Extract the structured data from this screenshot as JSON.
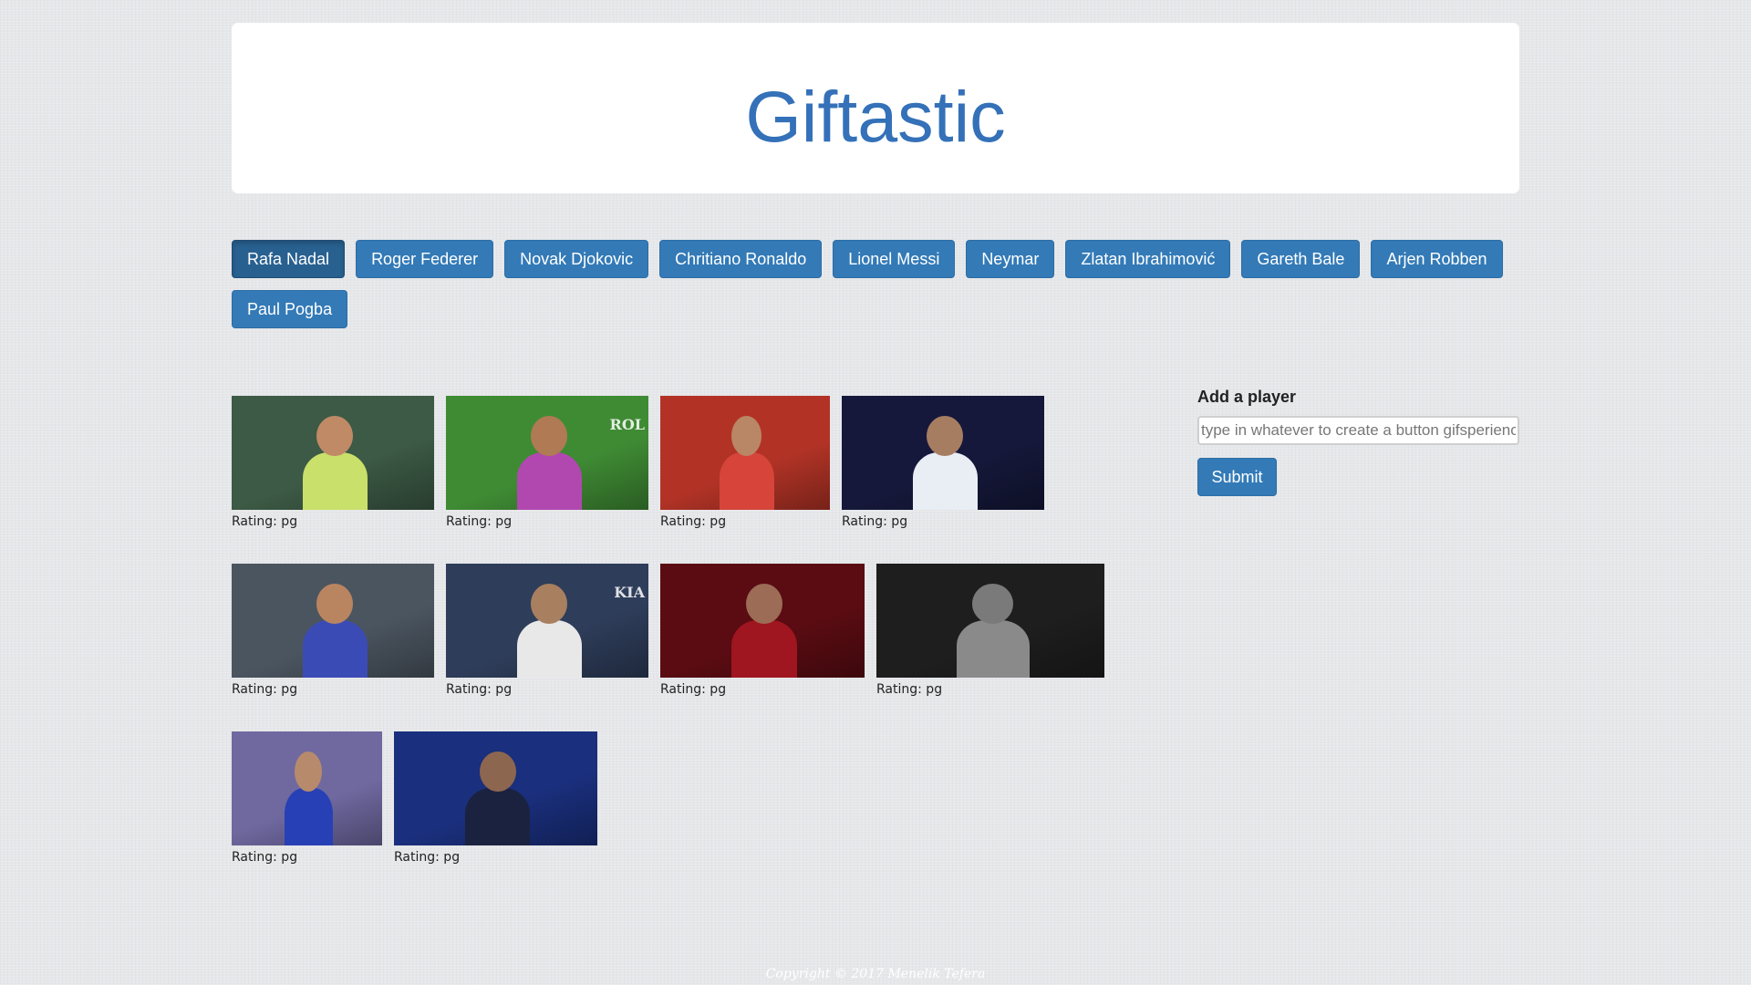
{
  "header": {
    "title": "Giftastic"
  },
  "player_buttons": [
    "Rafa Nadal",
    "Roger Federer",
    "Novak Djokovic",
    "Chritiano Ronaldo",
    "Lionel Messi",
    "Neymar",
    "Zlatan Ibrahimović",
    "Gareth Bale",
    "Arjen Robben",
    "Paul Pogba"
  ],
  "active_button": "Rafa Nadal",
  "gif_rows": [
    [
      {
        "rating": "Rating: pg",
        "bg": "#3c5a45",
        "accent": "#c9e06a",
        "skin": "#c08a66",
        "overlay": ""
      },
      {
        "rating": "Rating: pg",
        "bg": "#3f8b34",
        "accent": "#b048b0",
        "skin": "#b07a54",
        "overlay": "ROL"
      },
      {
        "rating": "Rating: pg",
        "bg": "#b23326",
        "accent": "#d6443a",
        "skin": "#b98765",
        "overlay": ""
      },
      {
        "rating": "Rating: pg",
        "bg": "#15183a",
        "accent": "#e9eef5",
        "skin": "#a77d62",
        "overlay": ""
      }
    ],
    [
      {
        "rating": "Rating: pg",
        "bg": "#4b5560",
        "accent": "#3b4bb5",
        "skin": "#b98560",
        "overlay": ""
      },
      {
        "rating": "Rating: pg",
        "bg": "#2e3d5a",
        "accent": "#e8e8e8",
        "skin": "#a8805f",
        "overlay": "KIA"
      },
      {
        "rating": "Rating: pg",
        "bg": "#5a0c12",
        "accent": "#9f1520",
        "skin": "#9c6c56",
        "overlay": ""
      },
      {
        "rating": "Rating: pg",
        "bg": "#1e1e1e",
        "accent": "#8a8a8a",
        "skin": "#7a7a7a",
        "overlay": ""
      }
    ],
    [
      {
        "rating": "Rating: pg",
        "bg": "#6f69a0",
        "accent": "#2740b5",
        "skin": "#b88a6c",
        "overlay": ""
      },
      {
        "rating": "Rating: pg",
        "bg": "#1a2f7d",
        "accent": "#1b2240",
        "skin": "#8d6650",
        "overlay": ""
      }
    ]
  ],
  "sidebar": {
    "label": "Add a player",
    "placeholder": "type in whatever to create a button gifsperience",
    "submit_label": "Submit"
  },
  "footer": {
    "text": "Copyright © 2017 Menelik Tefera"
  },
  "colors": {
    "brand": "#3471b8",
    "button": "#337ab7",
    "button_active": "#286090",
    "background": "#e6e7ea"
  }
}
